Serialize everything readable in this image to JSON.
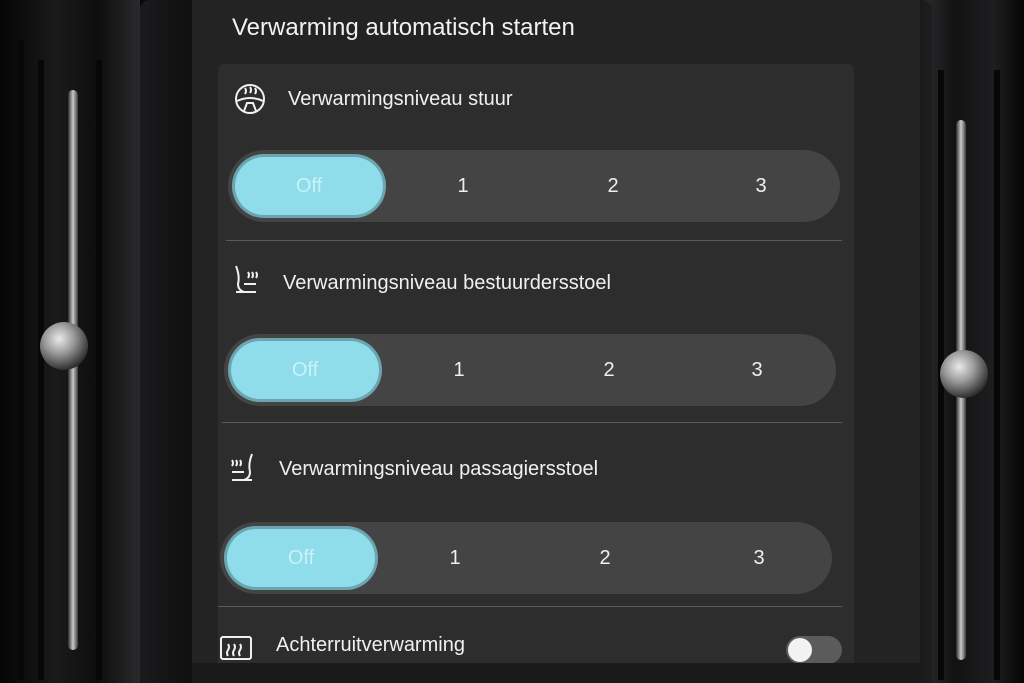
{
  "page_title": "Verwarming automatisch starten",
  "sections": [
    {
      "icon": "steering-wheel-heat-icon",
      "label": "Verwarmingsniveau stuur",
      "options": [
        "Off",
        "1",
        "2",
        "3"
      ],
      "selected": "Off"
    },
    {
      "icon": "driver-seat-heat-icon",
      "label": "Verwarmingsniveau bestuurdersstoel",
      "options": [
        "Off",
        "1",
        "2",
        "3"
      ],
      "selected": "Off"
    },
    {
      "icon": "passenger-seat-heat-icon",
      "label": "Verwarmingsniveau passagiersstoel",
      "options": [
        "Off",
        "1",
        "2",
        "3"
      ],
      "selected": "Off"
    }
  ],
  "rear_defrost": {
    "icon": "rear-window-defrost-icon",
    "label": "Achterruitverwarming",
    "toggle_on": false
  },
  "colors": {
    "accent": "#8fdcea",
    "panel": "#2d2d2e",
    "segment_track": "#444445"
  }
}
